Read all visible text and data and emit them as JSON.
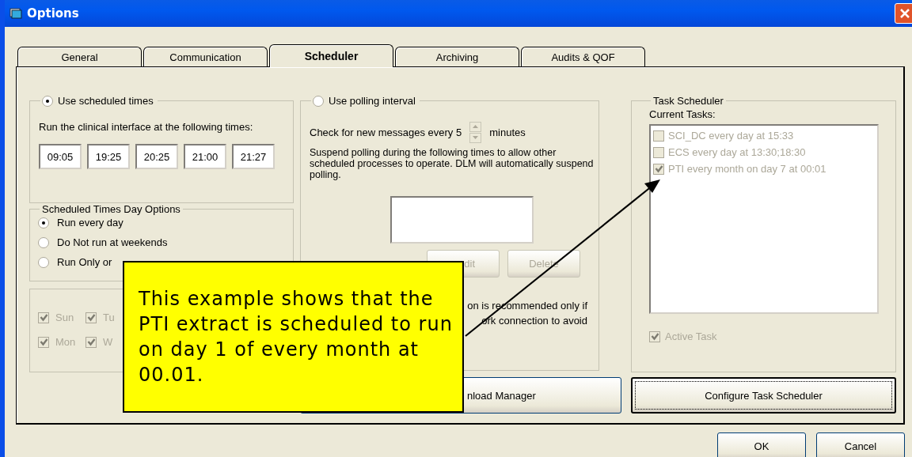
{
  "window": {
    "title": "Options"
  },
  "tabs": [
    {
      "label": "General",
      "selected": false
    },
    {
      "label": "Communication",
      "selected": false
    },
    {
      "label": "Scheduler",
      "selected": true
    },
    {
      "label": "Archiving",
      "selected": false
    },
    {
      "label": "Audits & QOF",
      "selected": false
    }
  ],
  "scheduled_times": {
    "label": "Use scheduled times",
    "selected": true,
    "instruction": "Run the clinical interface at the following times:",
    "times": [
      "09:05",
      "19:25",
      "20:25",
      "21:00",
      "21:27"
    ]
  },
  "day_options": {
    "title": "Scheduled Times Day Options",
    "options": [
      {
        "label": "Run every day",
        "selected": true
      },
      {
        "label": "Do Not run at weekends",
        "selected": false
      },
      {
        "label": "Run Only or",
        "selected": false
      }
    ]
  },
  "days": [
    {
      "label": "Sun",
      "checked": true,
      "disabled": true
    },
    {
      "label": "Tu",
      "checked": true,
      "disabled": true
    },
    {
      "label": "Mon",
      "checked": true,
      "disabled": true
    },
    {
      "label": "W",
      "checked": true,
      "disabled": true
    }
  ],
  "polling": {
    "label": "Use polling interval",
    "selected": false,
    "check_text": "Check for new messages every 5",
    "check_unit": "minutes",
    "suspend_note": "Suspend polling during the following times to allow other scheduled processes to operate. DLM will automatically suspend polling.",
    "buttons": [
      {
        "label": "dit",
        "disabled": true
      },
      {
        "label": "Delete",
        "disabled": true
      }
    ],
    "note_lines": [
      "on is recommended only if",
      "ork connection to avoid"
    ]
  },
  "download_manager_button": "nload Manager",
  "task_scheduler": {
    "title": "Task Scheduler",
    "list_label": "Current Tasks:",
    "disabled": true,
    "tasks": [
      {
        "label": "SCI_DC every day at 15:33",
        "checked": false
      },
      {
        "label": "ECS every day at 13:30;18:30",
        "checked": false
      },
      {
        "label": "PTI every month on day 7 at 00:01",
        "checked": true
      }
    ],
    "active_task": {
      "label": "Active Task",
      "checked": true
    }
  },
  "configure_button": "Configure Task Scheduler",
  "buttons": [
    "OK",
    "Cancel"
  ],
  "callout": {
    "text": "This example shows that the PTI extract is scheduled to run on day 1 of every month at 00.01."
  }
}
